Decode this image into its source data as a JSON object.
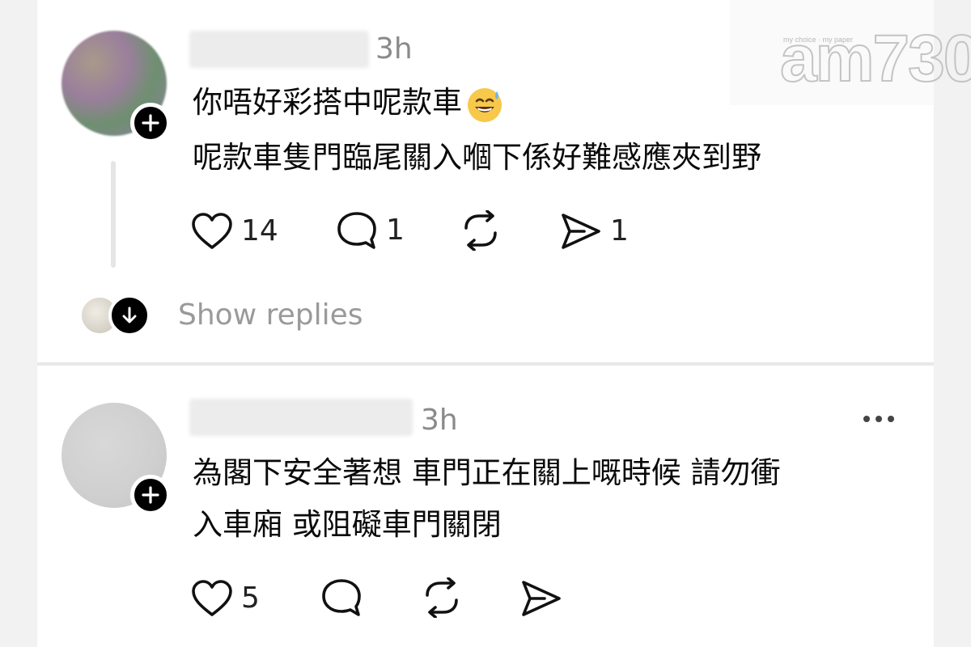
{
  "watermark": {
    "brand": "am730",
    "tagline": "my choice · my paper"
  },
  "posts": [
    {
      "time": "3h",
      "lines": [
        "你唔好彩搭中呢款車",
        "呢款車隻門臨尾關入嗰下係好難感應夾到野"
      ],
      "emoji": "sweat-smile-emoji",
      "likes": "14",
      "comments": "1",
      "shares": "1"
    },
    {
      "time": "3h",
      "lines": [
        "為閣下安全著想 車門正在關上嘅時候 請勿衝",
        "入車廂 或阻礙車門關閉"
      ],
      "likes": "5"
    }
  ],
  "show_replies_label": "Show replies",
  "icons": {
    "like": "heart-icon",
    "comment": "comment-bubble-icon",
    "repost": "repost-icon",
    "share": "send-icon",
    "more": "more-dots-icon",
    "follow": "plus-icon",
    "expand": "arrow-down-icon"
  },
  "colors": {
    "text": "#0a0a0a",
    "muted": "#8a8a8a",
    "badge": "#000000",
    "background": "#ffffff"
  }
}
